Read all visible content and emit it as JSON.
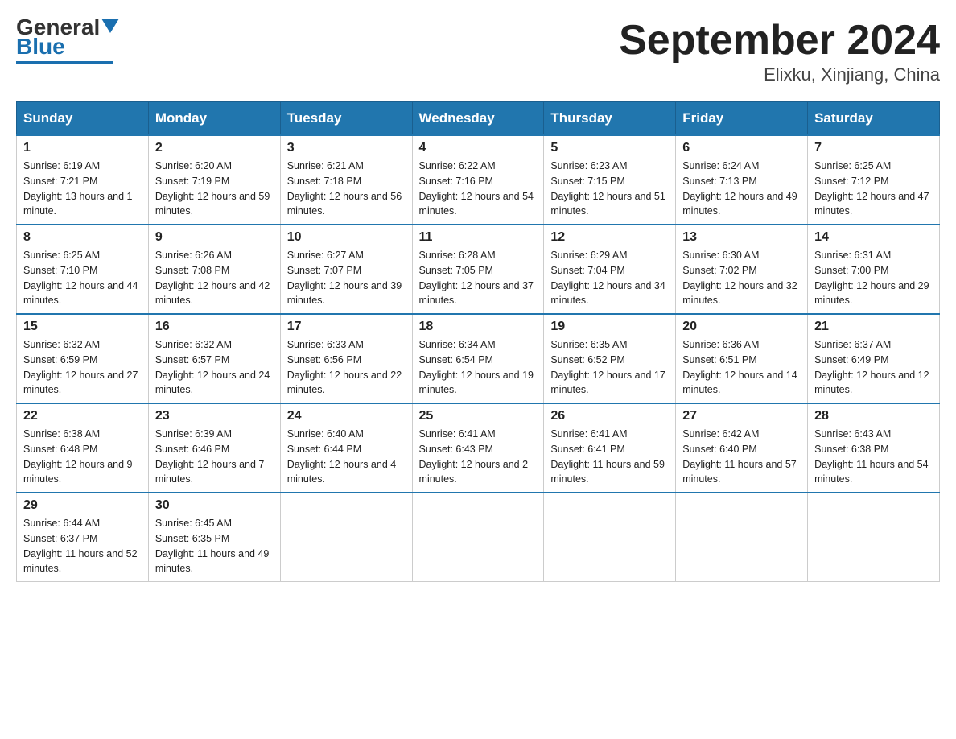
{
  "header": {
    "logo_general": "General",
    "logo_blue": "Blue",
    "month_title": "September 2024",
    "location": "Elixku, Xinjiang, China"
  },
  "weekdays": [
    "Sunday",
    "Monday",
    "Tuesday",
    "Wednesday",
    "Thursday",
    "Friday",
    "Saturday"
  ],
  "weeks": [
    [
      {
        "day": "1",
        "sunrise": "6:19 AM",
        "sunset": "7:21 PM",
        "daylight": "13 hours and 1 minute."
      },
      {
        "day": "2",
        "sunrise": "6:20 AM",
        "sunset": "7:19 PM",
        "daylight": "12 hours and 59 minutes."
      },
      {
        "day": "3",
        "sunrise": "6:21 AM",
        "sunset": "7:18 PM",
        "daylight": "12 hours and 56 minutes."
      },
      {
        "day": "4",
        "sunrise": "6:22 AM",
        "sunset": "7:16 PM",
        "daylight": "12 hours and 54 minutes."
      },
      {
        "day": "5",
        "sunrise": "6:23 AM",
        "sunset": "7:15 PM",
        "daylight": "12 hours and 51 minutes."
      },
      {
        "day": "6",
        "sunrise": "6:24 AM",
        "sunset": "7:13 PM",
        "daylight": "12 hours and 49 minutes."
      },
      {
        "day": "7",
        "sunrise": "6:25 AM",
        "sunset": "7:12 PM",
        "daylight": "12 hours and 47 minutes."
      }
    ],
    [
      {
        "day": "8",
        "sunrise": "6:25 AM",
        "sunset": "7:10 PM",
        "daylight": "12 hours and 44 minutes."
      },
      {
        "day": "9",
        "sunrise": "6:26 AM",
        "sunset": "7:08 PM",
        "daylight": "12 hours and 42 minutes."
      },
      {
        "day": "10",
        "sunrise": "6:27 AM",
        "sunset": "7:07 PM",
        "daylight": "12 hours and 39 minutes."
      },
      {
        "day": "11",
        "sunrise": "6:28 AM",
        "sunset": "7:05 PM",
        "daylight": "12 hours and 37 minutes."
      },
      {
        "day": "12",
        "sunrise": "6:29 AM",
        "sunset": "7:04 PM",
        "daylight": "12 hours and 34 minutes."
      },
      {
        "day": "13",
        "sunrise": "6:30 AM",
        "sunset": "7:02 PM",
        "daylight": "12 hours and 32 minutes."
      },
      {
        "day": "14",
        "sunrise": "6:31 AM",
        "sunset": "7:00 PM",
        "daylight": "12 hours and 29 minutes."
      }
    ],
    [
      {
        "day": "15",
        "sunrise": "6:32 AM",
        "sunset": "6:59 PM",
        "daylight": "12 hours and 27 minutes."
      },
      {
        "day": "16",
        "sunrise": "6:32 AM",
        "sunset": "6:57 PM",
        "daylight": "12 hours and 24 minutes."
      },
      {
        "day": "17",
        "sunrise": "6:33 AM",
        "sunset": "6:56 PM",
        "daylight": "12 hours and 22 minutes."
      },
      {
        "day": "18",
        "sunrise": "6:34 AM",
        "sunset": "6:54 PM",
        "daylight": "12 hours and 19 minutes."
      },
      {
        "day": "19",
        "sunrise": "6:35 AM",
        "sunset": "6:52 PM",
        "daylight": "12 hours and 17 minutes."
      },
      {
        "day": "20",
        "sunrise": "6:36 AM",
        "sunset": "6:51 PM",
        "daylight": "12 hours and 14 minutes."
      },
      {
        "day": "21",
        "sunrise": "6:37 AM",
        "sunset": "6:49 PM",
        "daylight": "12 hours and 12 minutes."
      }
    ],
    [
      {
        "day": "22",
        "sunrise": "6:38 AM",
        "sunset": "6:48 PM",
        "daylight": "12 hours and 9 minutes."
      },
      {
        "day": "23",
        "sunrise": "6:39 AM",
        "sunset": "6:46 PM",
        "daylight": "12 hours and 7 minutes."
      },
      {
        "day": "24",
        "sunrise": "6:40 AM",
        "sunset": "6:44 PM",
        "daylight": "12 hours and 4 minutes."
      },
      {
        "day": "25",
        "sunrise": "6:41 AM",
        "sunset": "6:43 PM",
        "daylight": "12 hours and 2 minutes."
      },
      {
        "day": "26",
        "sunrise": "6:41 AM",
        "sunset": "6:41 PM",
        "daylight": "11 hours and 59 minutes."
      },
      {
        "day": "27",
        "sunrise": "6:42 AM",
        "sunset": "6:40 PM",
        "daylight": "11 hours and 57 minutes."
      },
      {
        "day": "28",
        "sunrise": "6:43 AM",
        "sunset": "6:38 PM",
        "daylight": "11 hours and 54 minutes."
      }
    ],
    [
      {
        "day": "29",
        "sunrise": "6:44 AM",
        "sunset": "6:37 PM",
        "daylight": "11 hours and 52 minutes."
      },
      {
        "day": "30",
        "sunrise": "6:45 AM",
        "sunset": "6:35 PM",
        "daylight": "11 hours and 49 minutes."
      },
      null,
      null,
      null,
      null,
      null
    ]
  ],
  "labels": {
    "sunrise": "Sunrise: ",
    "sunset": "Sunset: ",
    "daylight": "Daylight: "
  }
}
